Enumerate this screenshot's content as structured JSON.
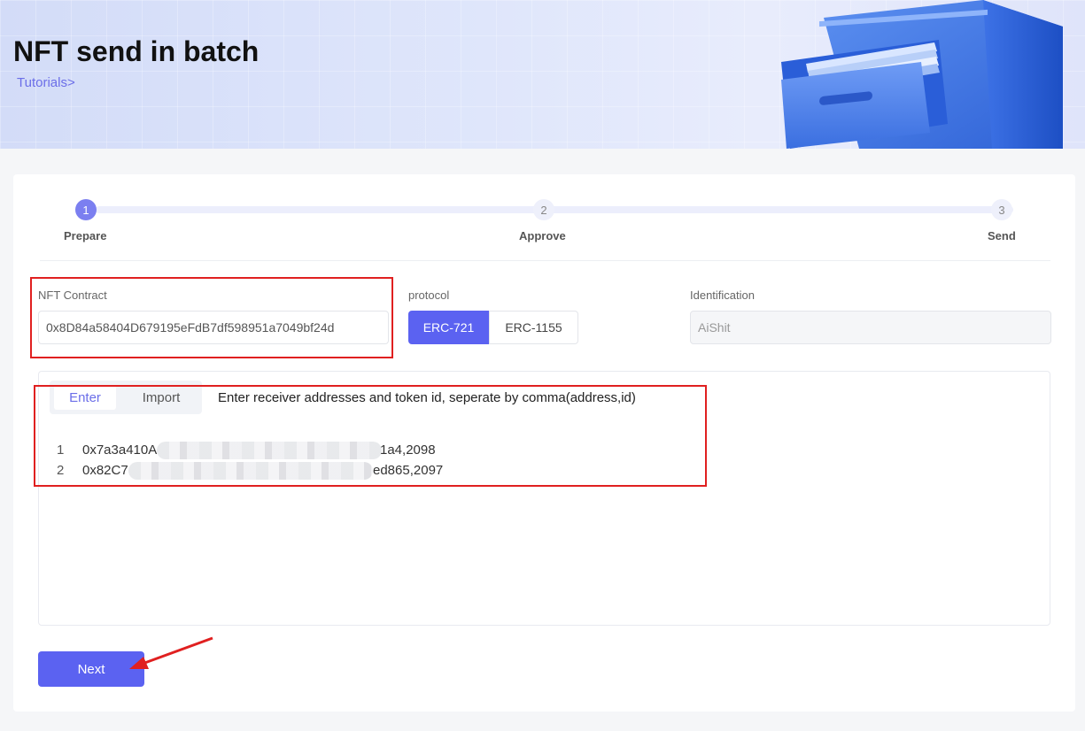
{
  "header": {
    "title": "NFT send in batch",
    "tutorials_link": "Tutorials>"
  },
  "steps": [
    {
      "number": "1",
      "label": "Prepare",
      "active": true
    },
    {
      "number": "2",
      "label": "Approve",
      "active": false
    },
    {
      "number": "3",
      "label": "Send",
      "active": false
    }
  ],
  "form": {
    "contract_label": "NFT Contract",
    "contract_value": "0x8D84a58404D679195eFdB7df598951a7049bf24d",
    "protocol_label": "protocol",
    "protocol_options": [
      "ERC-721",
      "ERC-1155"
    ],
    "protocol_selected": "ERC-721",
    "identification_label": "Identification",
    "identification_value": "AiShit"
  },
  "editor": {
    "tabs": [
      "Enter",
      "Import"
    ],
    "active_tab": "Enter",
    "hint": "Enter receiver addresses and token id, seperate by comma(address,id)",
    "lines": [
      {
        "no": "1",
        "prefix": "0x7a3a410A",
        "suffix": "1a4,2098"
      },
      {
        "no": "2",
        "prefix": "0x82C7",
        "suffix": "ed865,2097"
      }
    ]
  },
  "actions": {
    "next_label": "Next"
  },
  "colors": {
    "accent": "#5b62f1",
    "link": "#6b6ee8",
    "annotation": "#e02020"
  }
}
